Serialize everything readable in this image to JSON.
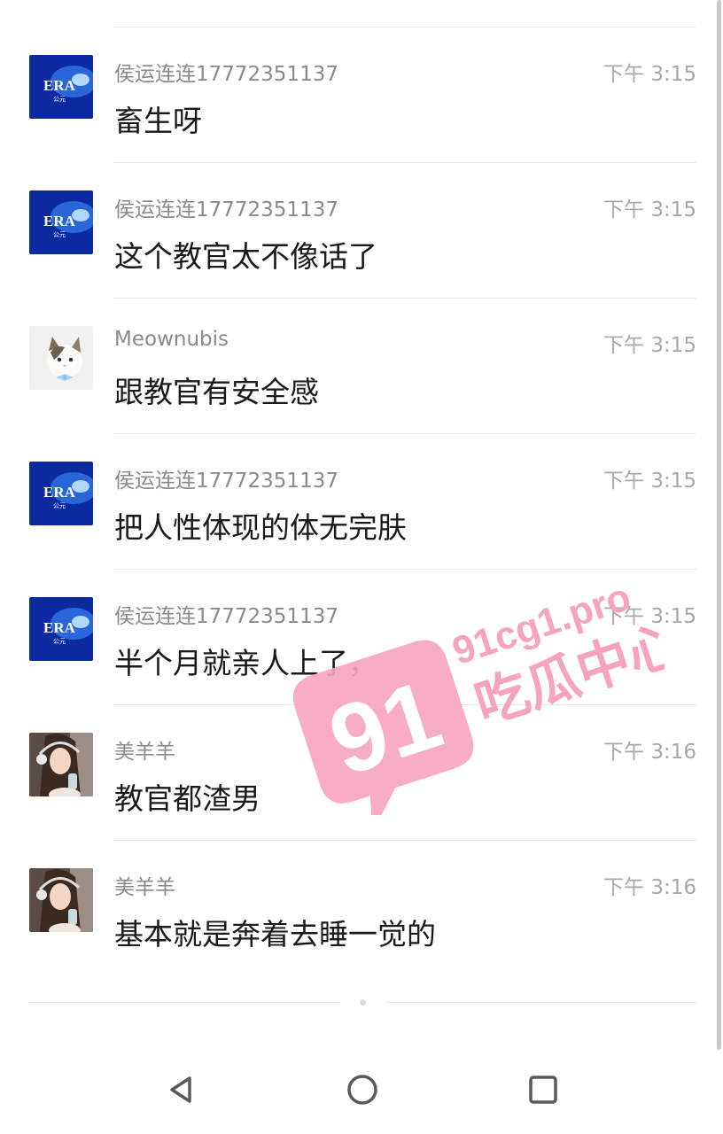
{
  "messages": [
    {
      "sender": "侯运连连17772351137",
      "time": "下午 3:15",
      "text": "畜生呀",
      "avatar": "era-logo"
    },
    {
      "sender": "侯运连连17772351137",
      "time": "下午 3:15",
      "text": "这个教官太不像话了",
      "avatar": "era-logo"
    },
    {
      "sender": "Meownubis",
      "time": "下午 3:15",
      "text": "跟教官有安全感",
      "avatar": "cat-photo"
    },
    {
      "sender": "侯运连连17772351137",
      "time": "下午 3:15",
      "text": "把人性体现的体无完肤",
      "avatar": "era-logo"
    },
    {
      "sender": "侯运连连17772351137",
      "time": "下午 3:15",
      "text": "半个月就亲人上了，",
      "avatar": "era-logo"
    },
    {
      "sender": "美羊羊",
      "time": "下午 3:16",
      "text": "教官都渣男",
      "avatar": "girl-photo"
    },
    {
      "sender": "美羊羊",
      "time": "下午 3:16",
      "text": "基本就是奔着去睡一觉的",
      "avatar": "girl-photo"
    }
  ],
  "avatar_logo_text": {
    "main": "ERA",
    "sub": "公元"
  },
  "watermark": {
    "number": "91",
    "domain": "91cg1.pro",
    "slogan": "吃瓜中心",
    "color": "#f7a3c0"
  },
  "nav": {
    "back": "back-triangle-icon",
    "home": "home-circle-icon",
    "recents": "recents-square-icon"
  },
  "colors": {
    "sender": "#8a8a8a",
    "time": "#a8a8a8",
    "text": "#1a1a1a",
    "divider": "#e6e6e6"
  }
}
